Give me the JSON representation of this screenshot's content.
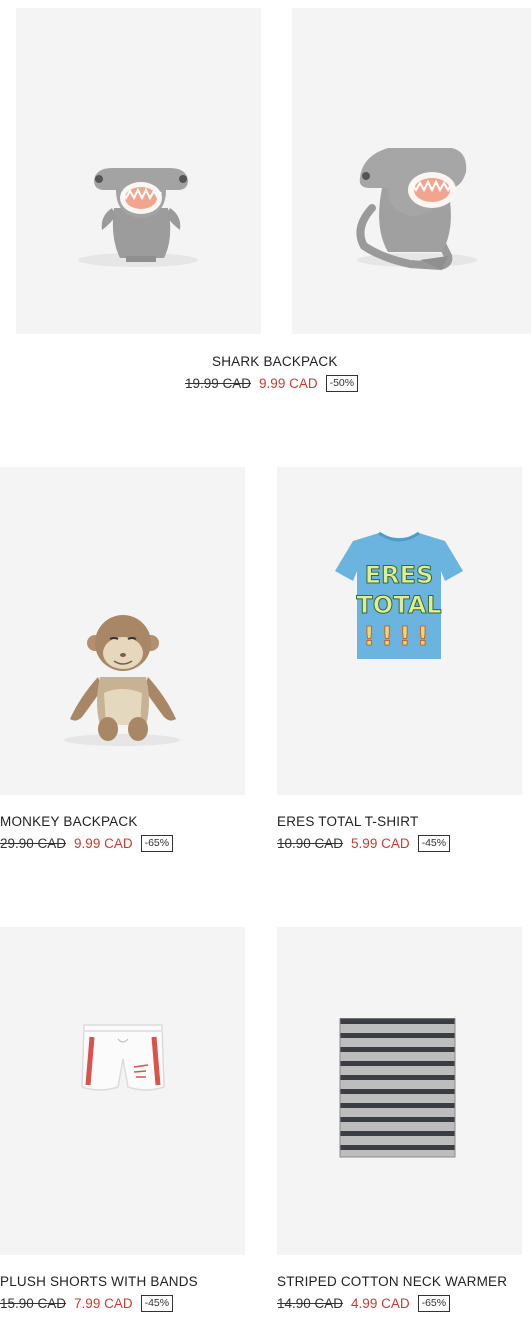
{
  "products": [
    {
      "name": "SHARK BACKPACK",
      "old_price": "19.99 CAD",
      "new_price": "9.99 CAD",
      "discount": "-50%",
      "image_icons": [
        "shark-backpack-front-image",
        "shark-backpack-side-image"
      ]
    },
    {
      "name": "MONKEY BACKPACK",
      "old_price": "29.90 CAD",
      "new_price": "9.99 CAD",
      "discount": "-65%",
      "image_icons": [
        "monkey-backpack-image"
      ]
    },
    {
      "name": "ERES TOTAL T-SHIRT",
      "old_price": "10.90 CAD",
      "new_price": "5.99 CAD",
      "discount": "-45%",
      "image_icons": [
        "tshirt-image"
      ],
      "print_text": [
        "ERES",
        "TOTAL",
        "!!!!"
      ]
    },
    {
      "name": "PLUSH SHORTS WITH BANDS",
      "old_price": "15.90 CAD",
      "new_price": "7.99 CAD",
      "discount": "-45%",
      "image_icons": [
        "shorts-image"
      ]
    },
    {
      "name": "STRIPED COTTON NECK WARMER",
      "old_price": "14.90 CAD",
      "new_price": "4.99 CAD",
      "discount": "-65%",
      "image_icons": [
        "neck-warmer-image"
      ]
    }
  ],
  "colors": {
    "sale_price": "#d03a2f",
    "image_background": "#f4f4f4",
    "text": "#222222"
  }
}
